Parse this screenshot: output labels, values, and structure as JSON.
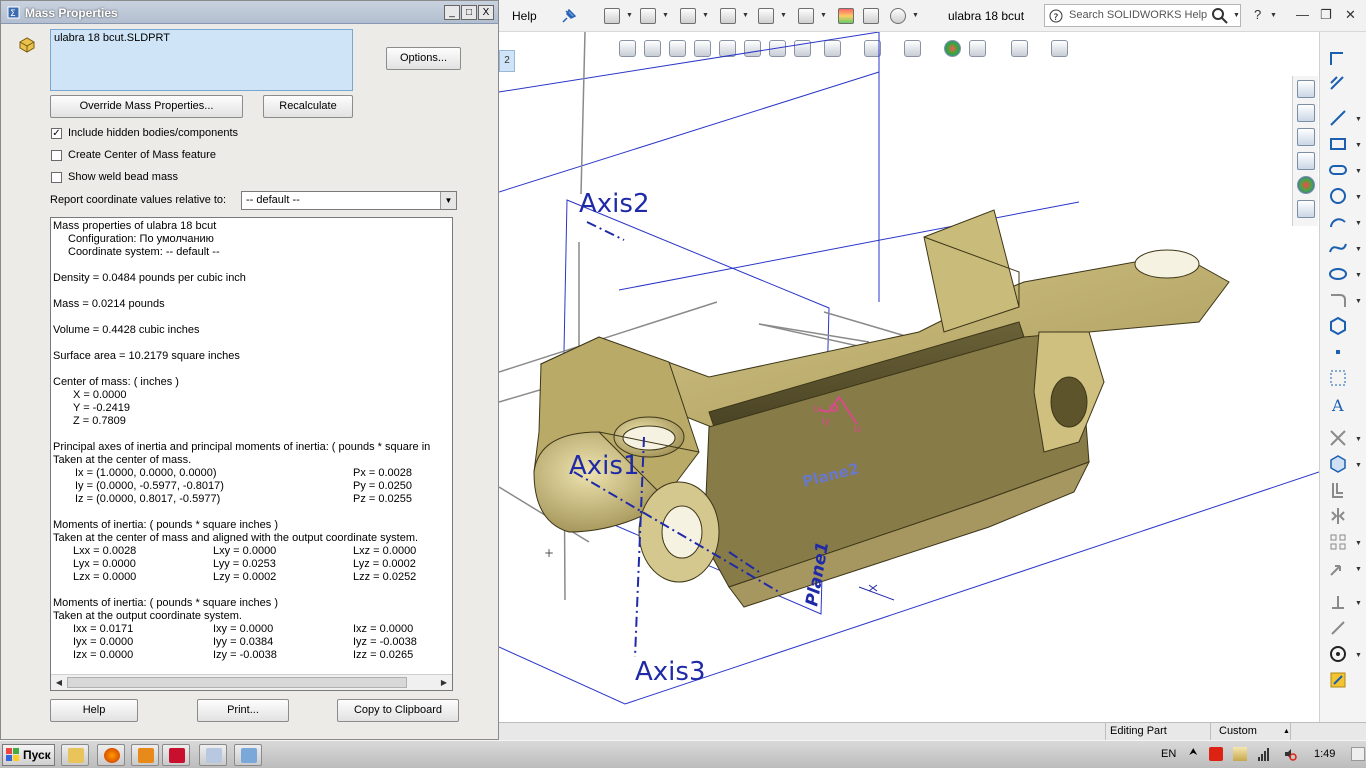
{
  "dialog": {
    "title": "Mass Properties",
    "title_buttons": [
      "_",
      "□",
      "X"
    ],
    "file_name": "ulabra 18 bcut.SLDPRT",
    "options_label": "Options...",
    "override_label": "Override Mass Properties...",
    "recalculate_label": "Recalculate",
    "checkboxes": [
      {
        "label": "Include hidden bodies/components",
        "checked": true
      },
      {
        "label": "Create Center of Mass feature",
        "checked": false
      },
      {
        "label": "Show weld bead mass",
        "checked": false
      }
    ],
    "check_mark": "✓",
    "report_label": "Report coordinate values relative to:",
    "coord_system": "-- default --",
    "results": {
      "header": "Mass properties of ulabra 18 bcut",
      "configuration": "Configuration: По умолчанию",
      "coord_line": "Coordinate system: -- default --",
      "density": "Density = 0.0484 pounds per cubic inch",
      "mass": "Mass = 0.0214 pounds",
      "volume": "Volume = 0.4428 cubic inches",
      "surface": "Surface area = 10.2179 square inches",
      "com_header": "Center of mass: ( inches )",
      "com_x": "X = 0.0000",
      "com_y": "Y = -0.2419",
      "com_z": "Z = 0.7809",
      "principal_header": "Principal axes of inertia and principal moments of inertia: ( pounds * square in",
      "taken_center": "Taken at the center of mass.",
      "ix": "Ix = (1.0000,  0.0000,  0.0000)",
      "iy": "Iy = (0.0000, -0.5977, -0.8017)",
      "iz": "Iz = (0.0000,  0.8017, -0.5977)",
      "px": "Px = 0.0028",
      "py": "Py = 0.0250",
      "pz": "Pz = 0.0255",
      "moi_header": "Moments of inertia: ( pounds * square inches )",
      "moi_aligned": "Taken at the center of mass and aligned with the output coordinate system.",
      "lxx": "Lxx = 0.0028",
      "lxy": "Lxy = 0.0000",
      "lxz": "Lxz = 0.0000",
      "lyx": "Lyx = 0.0000",
      "lyy": "Lyy = 0.0253",
      "lyz": "Lyz = 0.0002",
      "lzx": "Lzx = 0.0000",
      "lzy": "Lzy = 0.0002",
      "lzz": "Lzz = 0.0252",
      "moi2_header": "Moments of inertia: ( pounds * square inches )",
      "moi2_taken": "Taken at the output coordinate system.",
      "ixx": "Ixx = 0.0171",
      "ixy": "Ixy = 0.0000",
      "ixz": "Ixz = 0.0000",
      "iyx": "Iyx = 0.0000",
      "iyy": "Iyy = 0.0384",
      "iyz": "Iyz = -0.0038",
      "izx": "Izx = 0.0000",
      "izy": "Izy = -0.0038",
      "izz": "Izz = 0.0265"
    },
    "scroll_left": "◀",
    "scroll_right": "▶",
    "combo_arrow": "▼",
    "help_label": "Help",
    "print_label": "Print...",
    "copy_label": "Copy to Clipboard"
  },
  "sw": {
    "help_menu": "Help",
    "doc_title": "ulabra 18 bcut",
    "search_placeholder": "Search SOLIDWORKS Help",
    "help_glyph": "?",
    "tab_stub": "2",
    "labels": {
      "axis1": "Axis1",
      "axis2": "Axis2",
      "axis3": "Axis3",
      "plane1": "Plane1",
      "plane2": "Plane2",
      "ix": "Ix",
      "iy": "Iy",
      "iz": "Iz"
    },
    "status": {
      "mode": "Editing Part",
      "units": "Custom"
    }
  },
  "taskbar": {
    "start": "Пуск",
    "lang": "EN",
    "time": "1:49"
  },
  "colors": {
    "part_face": "#b8a96a",
    "part_dark": "#5c5330",
    "axis_blue": "#1f2aa8",
    "plane_line": "#2a36c8"
  }
}
